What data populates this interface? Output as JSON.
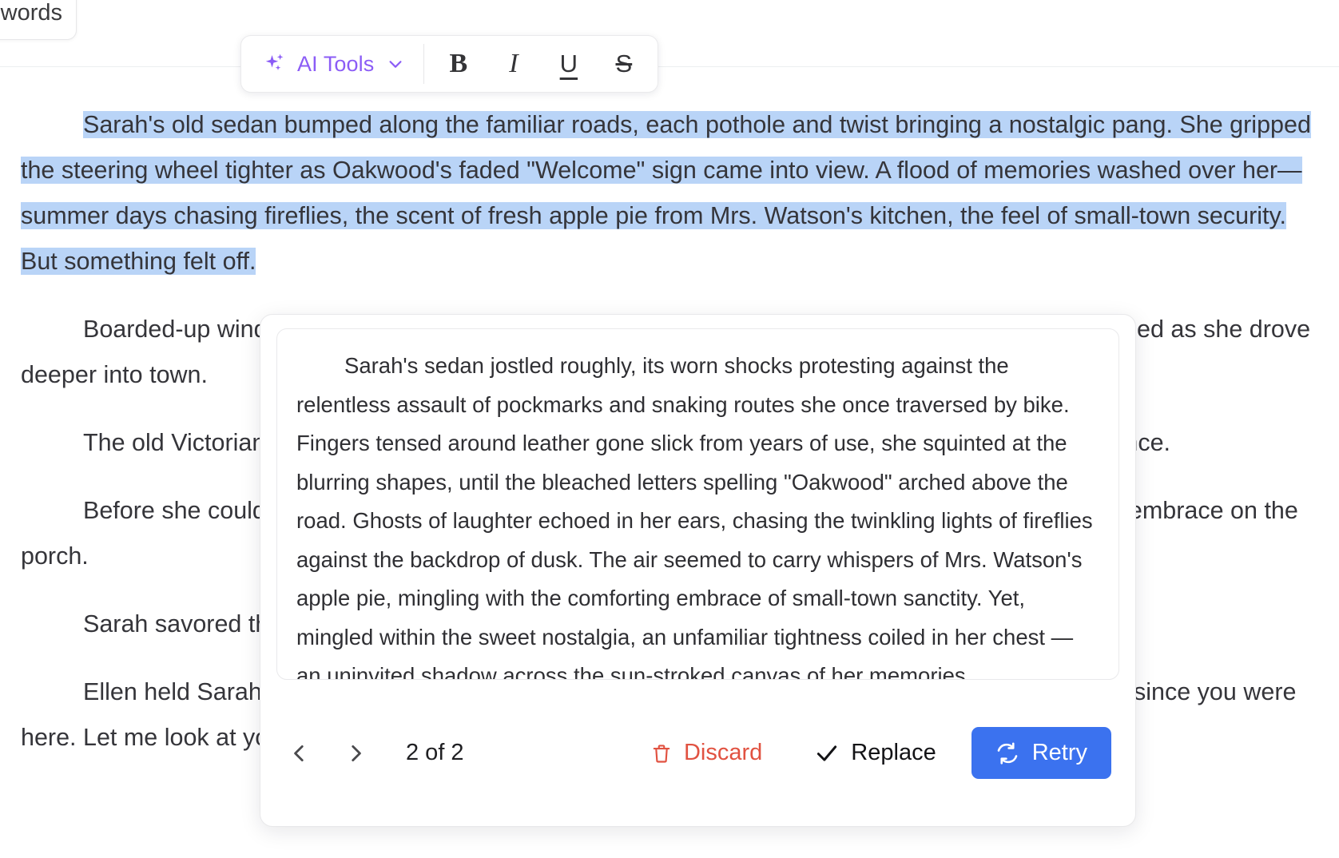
{
  "word_badge": {
    "label": "words"
  },
  "toolbar": {
    "ai_tools_label": "AI Tools",
    "bold_label": "B",
    "italic_label": "I",
    "underline_label": "U",
    "strikethrough_label": "S",
    "accent_color": "#8b5cf6"
  },
  "document": {
    "selection_color": "#b9d4f7",
    "selected_paragraph": "Sarah's old sedan bumped along the familiar roads, each pothole and twist bringing a nostalgic pang. She gripped the steering wheel tighter as Oakwood's faded \"Welcome\" sign came into view. A flood of memories washed over her—summer days chasing fireflies, the scent of fresh apple pie from Mrs. Watson's kitchen, the feel of small-town security. But something felt off.",
    "paragraphs": [
      "Boarded-up windows and empty storefronts replaced the bustling shops of her youth. Sarah frowned as she drove deeper into town.",
      "The old Victorian house loomed ahead. She cut the engine, the roar of the engine fading into silence.",
      "Before she could knock, the door swung open. Her mother, Ellen, pulled her daughter into a tight embrace on the porch.",
      "Sarah savored the familiar warmth of her mother's arms.",
      "Ellen held Sarah at arm's length, studying her face. \"You look tired, sweetheart. It's been too long since you were here. Let me look at you, dear.\" She brushed a lock of hair from Sarah's forehead with a gentle smile."
    ]
  },
  "ai_popup": {
    "suggestion": "Sarah's sedan jostled roughly, its worn shocks protesting against the relentless assault of pockmarks and snaking routes she once traversed by bike. Fingers tensed around leather gone slick from years of use, she squinted at the blurring shapes, until the bleached letters spelling \"Oakwood\" arched above the road. Ghosts of laughter echoed in her ears, chasing the twinkling lights of fireflies against the backdrop of dusk. The air seemed to carry whispers of Mrs. Watson's apple pie, mingling with the comforting embrace of small-town sanctity. Yet, mingled within the sweet nostalgia, an unfamiliar tightness coiled in her chest — an uninvited shadow across the sun-stroked canvas of her memories.",
    "counter": "2 of 2",
    "prev_label": "‹",
    "next_label": "›",
    "discard_label": "Discard",
    "replace_label": "Replace",
    "retry_label": "Retry",
    "discard_color": "#e15241",
    "retry_bg_color": "#3b72ef"
  }
}
